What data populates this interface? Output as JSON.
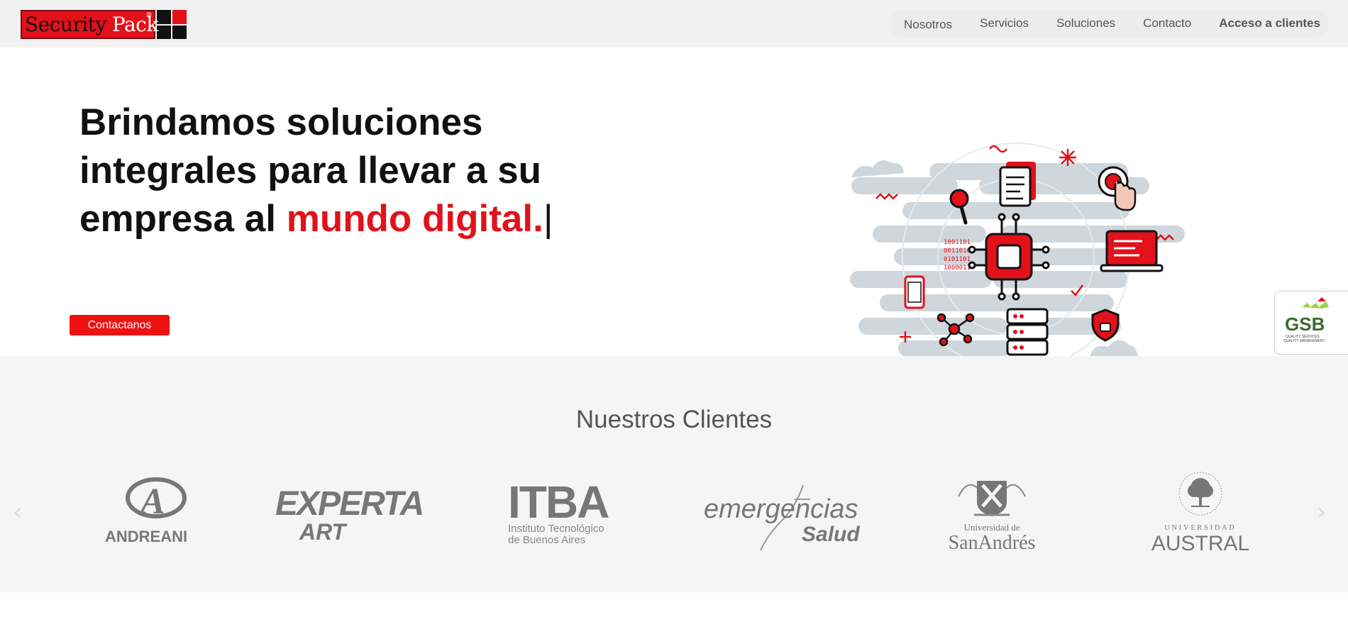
{
  "nav": {
    "logo": {
      "part1": "Security",
      "part2": "Pack",
      "reg": "®"
    },
    "items": [
      {
        "label": "Nosotros"
      },
      {
        "label": "Servicios"
      },
      {
        "label": "Soluciones"
      },
      {
        "label": "Contacto"
      },
      {
        "label": "Acceso a clientes"
      }
    ]
  },
  "hero": {
    "line1": "Brindamos soluciones",
    "line2": "integrales para llevar a su",
    "line3_prefix": "empresa al ",
    "line3_accent": "mundo digital.",
    "cursor": "|",
    "cta_label": "Contactanos",
    "binary": [
      "1001101",
      "0011010",
      "0101101",
      "1000011"
    ]
  },
  "badge": {
    "name": "GSB",
    "line1": "QUALITY SERVICES",
    "line2": "QUALITY MANAGEMENT"
  },
  "clients": {
    "title": "Nuestros Clientes",
    "prev_arrow": "‹",
    "next_arrow": "›",
    "logos": [
      {
        "name": "ANDREANI",
        "mark": "A"
      },
      {
        "line1": "EXPERTA",
        "line2": "ART"
      },
      {
        "name": "ITBA",
        "sub1": "Instituto Tecnológico",
        "sub2": "de Buenos Aires"
      },
      {
        "line1": "emergencias",
        "line2": "Salud"
      },
      {
        "line1": "Universidad de",
        "line2": "SanAndrés",
        "seal": "UNIVERSIDAD DE SAN ANDRES"
      },
      {
        "line1": "UNIVERSIDAD",
        "line2": "AUSTRAL",
        "ring": "AUSTRALIS UNIVERSITAS"
      }
    ]
  },
  "colors": {
    "accent": "#e2111a",
    "nav_bg": "#f1f1f1",
    "clients_bg": "#f5f5f5"
  },
  "icons": [
    "document-icon",
    "magnifier-icon",
    "touch-icon",
    "chip-icon",
    "laptop-icon",
    "phone-icon",
    "network-icon",
    "shield-lock-icon",
    "server-icon",
    "cloud-icon"
  ]
}
